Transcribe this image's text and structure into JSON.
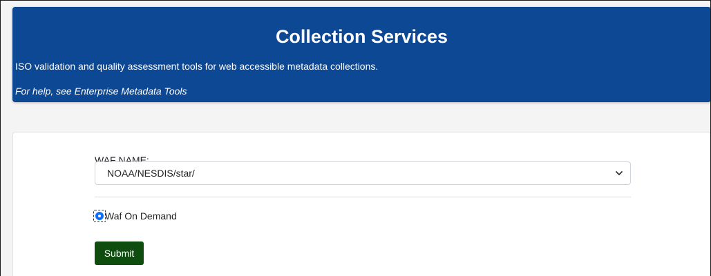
{
  "header": {
    "title": "Collection Services",
    "subtitle": "ISO validation and quality assessment tools for web accessible metadata collections.",
    "help_text": "For help, see Enterprise Metadata Tools"
  },
  "form": {
    "waf_label": "WAF NAME:",
    "waf_selected": "NOAA/NESDIS/star/",
    "radio_label": "Waf On Demand",
    "radio_checked": true,
    "submit_label": "Submit"
  },
  "colors": {
    "banner": "#0d4895",
    "submit": "#0e4d0e",
    "radio": "#0d6efd"
  },
  "icons": {
    "select_caret": "chevron-down-icon"
  }
}
